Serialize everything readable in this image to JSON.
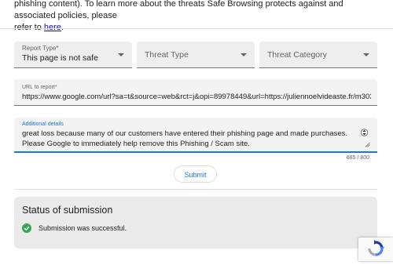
{
  "intro": {
    "line1": "phishing content). To learn more about the threats Safe Browsing protects against and associated policies, please",
    "line2_prefix": "refer to ",
    "link_text": "here",
    "line2_suffix": "."
  },
  "report_type": {
    "label": "Report Type*",
    "value": "This page is not safe"
  },
  "threat_type": {
    "placeholder": "Threat Type"
  },
  "threat_category": {
    "placeholder": "Threat Category"
  },
  "url_field": {
    "label": "URL to report*",
    "value": "https://www.google.com/url?sa=t&source=web&rct=j&opi=89978449&url=https://juliennoelvideaste.fr/m303-b"
  },
  "details_field": {
    "label": "Additional details",
    "value": "great loss because many of our customers have entered their phishing page and made purchases. Please Google to immediately help remove this Phishing / Scam site."
  },
  "char_counter": "685 / 800",
  "submit": {
    "label": "Submit"
  },
  "status": {
    "title": "Status of submission",
    "message": "Submission was successful."
  },
  "colors": {
    "accent": "#1a73e8",
    "success": "#34a853",
    "link": "#1a0dab"
  }
}
